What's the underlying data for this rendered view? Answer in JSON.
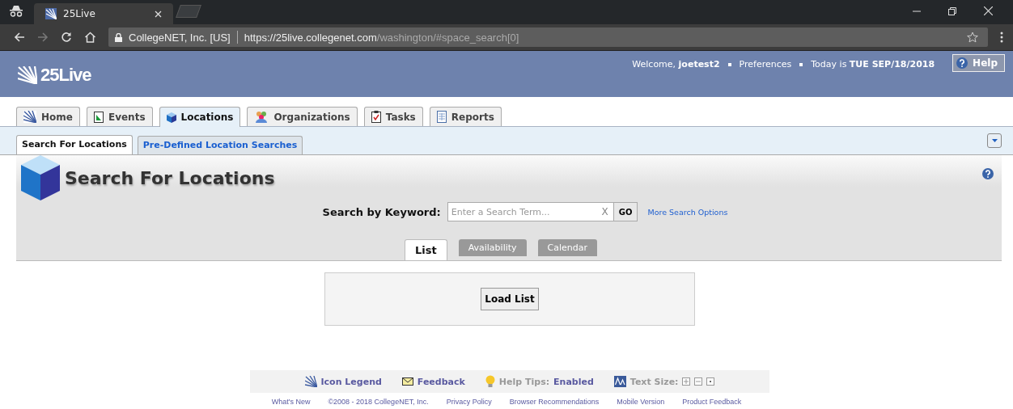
{
  "browser": {
    "tab_title": "25Live",
    "site_label": "CollegeNET, Inc. [US]",
    "url_host": "https://25live.collegenet.com",
    "url_path": "/washington/#space_search[0]"
  },
  "header": {
    "logo": "25Live",
    "welcome": "Welcome, **joetest2**",
    "preferences": "Preferences",
    "today": "Today is **TUE SEP/18/2018**",
    "help": "Help"
  },
  "main_tabs": [
    {
      "label": "Home",
      "kind": "home",
      "selected": false
    },
    {
      "label": "Events",
      "kind": "events",
      "selected": false
    },
    {
      "label": "Locations",
      "kind": "locations",
      "selected": true
    },
    {
      "label": "Organizations",
      "kind": "organizations",
      "selected": false
    },
    {
      "label": "Tasks",
      "kind": "tasks",
      "selected": false
    },
    {
      "label": "Reports",
      "kind": "reports",
      "selected": false
    }
  ],
  "sub_tabs": [
    {
      "label": "Search For Locations",
      "selected": true
    },
    {
      "label": "Pre-Defined Location Searches",
      "selected": false
    }
  ],
  "page_title": "Search For Locations",
  "search": {
    "label": "Search by Keyword:",
    "placeholder": "Enter a Search Term...",
    "clear": "X",
    "go": "GO",
    "more": "More Search Options"
  },
  "view_tabs": [
    {
      "label": "List",
      "selected": true
    },
    {
      "label": "Availability",
      "selected": false
    },
    {
      "label": "Calendar",
      "selected": false
    }
  ],
  "load_button": "Load List",
  "footer": {
    "icon_legend": "Icon Legend",
    "feedback": "Feedback",
    "help_tips_label": "Help Tips:",
    "help_tips_value": "Enabled",
    "text_size": "Text Size:"
  },
  "footer_links": [
    "What's New",
    "©2008 - 2018 CollegeNET, Inc.",
    "Privacy Policy",
    "Browser Recommendations",
    "Mobile Version",
    "Product Feedback"
  ]
}
